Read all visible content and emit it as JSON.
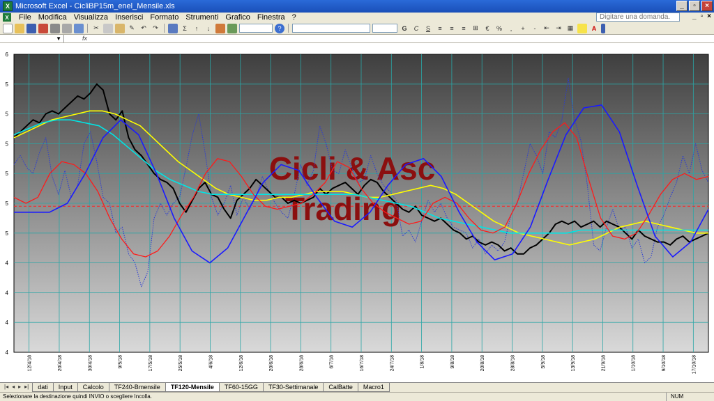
{
  "window": {
    "title": "Microsoft Excel - CicliBP15m_enel_Mensile.xls",
    "controls": [
      "_",
      "▫",
      "×"
    ]
  },
  "menu": {
    "items": [
      "File",
      "Modifica",
      "Visualizza",
      "Inserisci",
      "Formato",
      "Strumenti",
      "Grafico",
      "Finestra",
      "?"
    ],
    "help_placeholder": "Digitare una domanda.",
    "doc_controls": [
      "_",
      "▫",
      "×"
    ]
  },
  "formula": {
    "fx_label": "fx"
  },
  "chart_data": {
    "type": "line",
    "watermark": [
      "Cicli & Asc",
      "Trading"
    ],
    "y_ticks": [
      "6",
      "5",
      "5",
      "5",
      "5",
      "5",
      "5",
      "4",
      "4",
      "4",
      "4"
    ],
    "x_labels": [
      "12/4/18",
      "20/4/18",
      "30/4/18",
      "9/5/18",
      "17/5/18",
      "25/5/18",
      "4/6/18",
      "12/6/18",
      "20/6/18",
      "28/6/18",
      "6/7/18",
      "16/7/18",
      "24/7/18",
      "1/8/18",
      "9/8/18",
      "20/8/18",
      "28/8/18",
      "5/9/18",
      "13/9/18",
      "21/9/18",
      "1/10/18",
      "9/10/18",
      "17/10/18"
    ],
    "reference_level": 0.49,
    "grid": true,
    "background_top": "#3f3f3f",
    "background_bottom": "#d9d9d9",
    "series": [
      {
        "color": "#2a3bd6",
        "style": "dotted",
        "values": [
          0.63,
          0.66,
          0.62,
          0.6,
          0.67,
          0.72,
          0.59,
          0.53,
          0.61,
          0.52,
          0.56,
          0.7,
          0.74,
          0.64,
          0.52,
          0.5,
          0.4,
          0.42,
          0.33,
          0.3,
          0.22,
          0.27,
          0.45,
          0.5,
          0.46,
          0.5,
          0.52,
          0.62,
          0.73,
          0.8,
          0.67,
          0.52,
          0.46,
          0.5,
          0.56,
          0.46,
          0.52,
          0.48,
          0.52,
          0.59,
          0.54,
          0.5,
          0.47,
          0.45,
          0.53,
          0.63,
          0.56,
          0.61,
          0.76,
          0.7,
          0.61,
          0.6,
          0.68,
          0.62,
          0.57,
          0.58,
          0.66,
          0.6,
          0.56,
          0.54,
          0.51,
          0.39,
          0.41,
          0.37,
          0.44,
          0.51,
          0.47,
          0.5,
          0.45,
          0.42,
          0.41,
          0.4,
          0.35,
          0.38,
          0.33,
          0.36,
          0.34,
          0.37,
          0.46,
          0.5,
          0.6,
          0.7,
          0.66,
          0.6,
          0.74,
          0.72,
          0.78,
          0.92,
          0.78,
          0.71,
          0.56,
          0.36,
          0.34,
          0.42,
          0.48,
          0.41,
          0.42,
          0.35,
          0.38,
          0.3,
          0.32,
          0.42,
          0.46,
          0.52,
          0.57,
          0.66,
          0.6,
          0.7,
          0.61,
          0.57
        ]
      },
      {
        "color": "#000000",
        "style": "solid",
        "values": [
          0.72,
          0.74,
          0.76,
          0.78,
          0.77,
          0.8,
          0.81,
          0.8,
          0.82,
          0.84,
          0.86,
          0.85,
          0.87,
          0.9,
          0.88,
          0.8,
          0.78,
          0.81,
          0.72,
          0.68,
          0.66,
          0.63,
          0.6,
          0.58,
          0.57,
          0.55,
          0.5,
          0.47,
          0.51,
          0.55,
          0.57,
          0.53,
          0.52,
          0.48,
          0.45,
          0.51,
          0.53,
          0.55,
          0.58,
          0.56,
          0.54,
          0.52,
          0.52,
          0.5,
          0.51,
          0.5,
          0.51,
          0.52,
          0.55,
          0.53,
          0.55,
          0.56,
          0.57,
          0.55,
          0.53,
          0.56,
          0.58,
          0.57,
          0.54,
          0.52,
          0.5,
          0.48,
          0.47,
          0.49,
          0.46,
          0.45,
          0.44,
          0.45,
          0.43,
          0.41,
          0.4,
          0.38,
          0.39,
          0.37,
          0.36,
          0.37,
          0.36,
          0.34,
          0.35,
          0.33,
          0.33,
          0.35,
          0.36,
          0.38,
          0.4,
          0.43,
          0.44,
          0.43,
          0.44,
          0.42,
          0.43,
          0.44,
          0.42,
          0.44,
          0.43,
          0.42,
          0.4,
          0.38,
          0.41,
          0.39,
          0.38,
          0.37,
          0.37,
          0.36,
          0.38,
          0.39,
          0.37,
          0.38,
          0.39,
          0.4
        ]
      },
      {
        "color": "#ffff00",
        "style": "solid",
        "values": [
          0.72,
          0.74,
          0.76,
          0.78,
          0.79,
          0.8,
          0.81,
          0.81,
          0.8,
          0.78,
          0.76,
          0.72,
          0.68,
          0.64,
          0.61,
          0.58,
          0.55,
          0.53,
          0.52,
          0.51,
          0.51,
          0.52,
          0.52,
          0.53,
          0.54,
          0.54,
          0.54,
          0.53,
          0.52,
          0.52,
          0.53,
          0.54,
          0.55,
          0.56,
          0.55,
          0.53,
          0.5,
          0.47,
          0.44,
          0.42,
          0.4,
          0.39,
          0.38,
          0.37,
          0.36,
          0.37,
          0.38,
          0.4,
          0.42,
          0.43,
          0.44,
          0.43,
          0.42,
          0.41,
          0.4,
          0.4
        ]
      },
      {
        "color": "#00e5e5",
        "style": "solid",
        "values": [
          0.73,
          0.75,
          0.77,
          0.78,
          0.78,
          0.77,
          0.76,
          0.73,
          0.69,
          0.65,
          0.61,
          0.58,
          0.56,
          0.54,
          0.53,
          0.53,
          0.53,
          0.53,
          0.53,
          0.53,
          0.53,
          0.53,
          0.53,
          0.53,
          0.53,
          0.52,
          0.51,
          0.5,
          0.49,
          0.47,
          0.45,
          0.44,
          0.43,
          0.42,
          0.41,
          0.4,
          0.4,
          0.4,
          0.4,
          0.4,
          0.41,
          0.41,
          0.41,
          0.41,
          0.41,
          0.41,
          0.41,
          0.41,
          0.41,
          0.41
        ]
      },
      {
        "color": "#ff1a1a",
        "style": "solid",
        "values": [
          0.52,
          0.5,
          0.52,
          0.6,
          0.64,
          0.63,
          0.6,
          0.54,
          0.45,
          0.38,
          0.33,
          0.32,
          0.34,
          0.39,
          0.46,
          0.52,
          0.6,
          0.65,
          0.64,
          0.59,
          0.53,
          0.49,
          0.48,
          0.49,
          0.5,
          0.53,
          0.57,
          0.64,
          0.62,
          0.55,
          0.5,
          0.47,
          0.45,
          0.43,
          0.44,
          0.5,
          0.52,
          0.5,
          0.45,
          0.41,
          0.4,
          0.42,
          0.5,
          0.6,
          0.68,
          0.74,
          0.77,
          0.72,
          0.58,
          0.45,
          0.39,
          0.38,
          0.4,
          0.46,
          0.53,
          0.58,
          0.6,
          0.58,
          0.59
        ]
      },
      {
        "color": "#1a1aff",
        "style": "solid",
        "values": [
          0.47,
          0.47,
          0.47,
          0.5,
          0.6,
          0.72,
          0.78,
          0.73,
          0.6,
          0.45,
          0.34,
          0.3,
          0.35,
          0.46,
          0.57,
          0.63,
          0.61,
          0.52,
          0.44,
          0.42,
          0.47,
          0.56,
          0.63,
          0.65,
          0.59,
          0.47,
          0.37,
          0.31,
          0.33,
          0.42,
          0.58,
          0.73,
          0.82,
          0.83,
          0.74,
          0.56,
          0.39,
          0.32,
          0.37,
          0.48
        ]
      }
    ]
  },
  "tabs": {
    "nav": [
      "|◂",
      "◂",
      "▸",
      "▸|"
    ],
    "items": [
      "dati",
      "Input",
      "Calcolo",
      "TF240-Bmensile",
      "TF120-Mensile",
      "TF60-15GG",
      "TF30-Settimanale",
      "CalBatte",
      "Macro1"
    ],
    "active": 4
  },
  "status": {
    "message": "Selezionare la destinazione quindi INVIO o scegliere Incolla.",
    "num": "NUM"
  }
}
